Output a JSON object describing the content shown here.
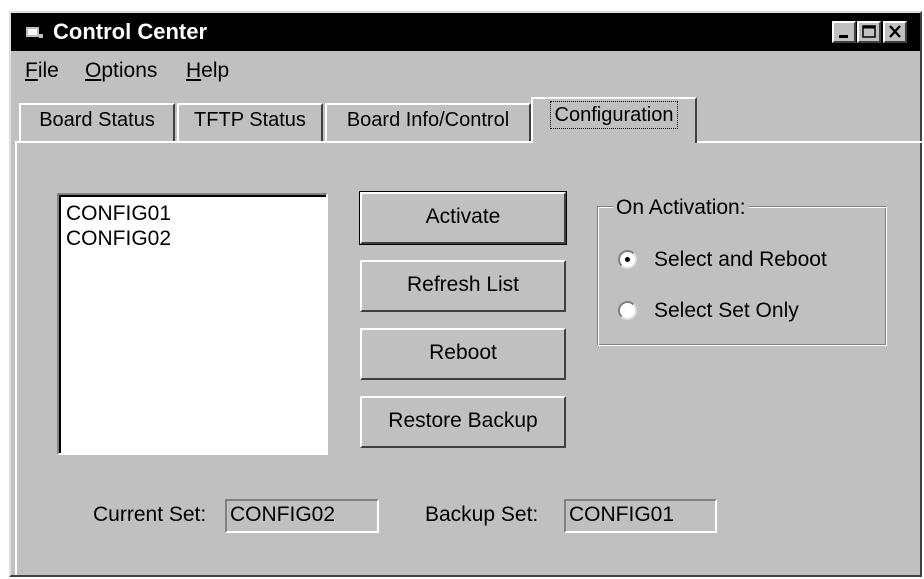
{
  "window": {
    "title": "Control Center",
    "controls": [
      "minimize",
      "maximize",
      "close"
    ]
  },
  "menu": {
    "items": [
      {
        "label": "File",
        "mnemonic": "F",
        "rest": "ile"
      },
      {
        "label": "Options",
        "mnemonic": "O",
        "rest": "ptions"
      },
      {
        "label": "Help",
        "mnemonic": "H",
        "rest": "elp"
      }
    ]
  },
  "tabs": {
    "items": [
      {
        "label": "Board Status"
      },
      {
        "label": "TFTP Status"
      },
      {
        "label": "Board Info/Control"
      },
      {
        "label": "Configuration"
      }
    ],
    "active": "Configuration"
  },
  "config_list": {
    "items": [
      "CONFIG01",
      "CONFIG02"
    ]
  },
  "buttons": {
    "activate": "Activate",
    "refresh": "Refresh List",
    "reboot": "Reboot",
    "restore": "Restore Backup"
  },
  "activation_group": {
    "label": "On Activation:",
    "options": [
      {
        "label": "Select and Reboot",
        "selected": true
      },
      {
        "label": "Select Set Only",
        "selected": false
      }
    ]
  },
  "status": {
    "current_label": "Current Set:",
    "current_value": "CONFIG02",
    "backup_label": "Backup Set:",
    "backup_value": "CONFIG01"
  },
  "icons": {
    "app": "app-window-icon",
    "minimize": "minimize-icon",
    "maximize": "maximize-icon",
    "close": "close-icon",
    "radio_selected": "radio-selected-icon",
    "radio_unselected": "radio-unselected-icon"
  },
  "colors": {
    "face": "#c0c0c0",
    "titlebar": "#000000",
    "field": "#ffffff"
  }
}
